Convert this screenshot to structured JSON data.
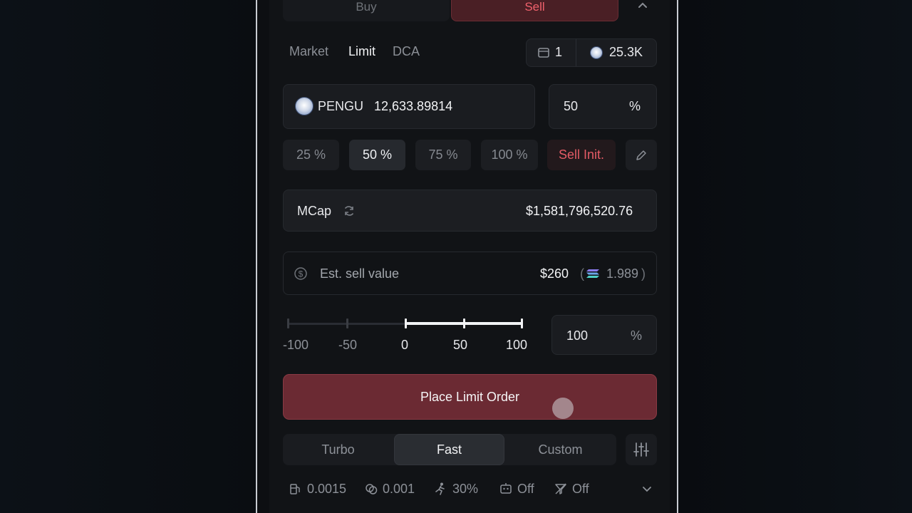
{
  "trade_tabs": {
    "buy": "Buy",
    "sell": "Sell"
  },
  "order_types": [
    "Market",
    "Limit",
    "DCA"
  ],
  "header_stats": {
    "wallet_count": "1",
    "token_value": "25.3K"
  },
  "amount": {
    "token_symbol": "PENGU",
    "token_amount": "12,633.89814",
    "percent_value": "50",
    "percent_symbol": "%"
  },
  "quick_buttons": [
    "25 %",
    "50 %",
    "75 %",
    "100 %",
    "Sell Init."
  ],
  "mcap": {
    "label": "MCap",
    "value": "$1,581,796,520.76"
  },
  "estimate": {
    "label": "Est. sell value",
    "usd": "$260",
    "paren_open": "(",
    "sol_amount": "1.989",
    "paren_close": ")"
  },
  "slippage_slider": {
    "ticks": [
      "-100",
      "-50",
      "0",
      "50",
      "100"
    ],
    "current_value": 100,
    "input_value": "100",
    "input_suffix": "%"
  },
  "place_button": "Place Limit Order",
  "speed_modes": [
    "Turbo",
    "Fast",
    "Custom"
  ],
  "footer": {
    "priority_fee": "0.0015",
    "bribe": "0.001",
    "slippage": "30%",
    "mev": "Off",
    "anti": "Off"
  },
  "colors": {
    "sell_accent": "#e45b66",
    "place_button": "#6b2a33",
    "background": "#111316"
  }
}
